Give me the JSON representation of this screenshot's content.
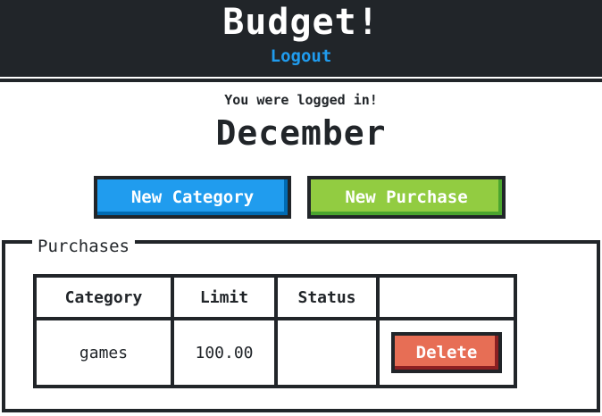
{
  "header": {
    "title": "Budget!",
    "logout_label": "Logout"
  },
  "flash": "You were logged in!",
  "month": "December",
  "actions": {
    "new_category_label": "New Category",
    "new_purchase_label": "New Purchase"
  },
  "purchases": {
    "legend": "Purchases",
    "columns": [
      "Category",
      "Limit",
      "Status",
      ""
    ],
    "rows": [
      {
        "category": "games",
        "limit": "100.00",
        "status": "",
        "action_label": "Delete"
      }
    ]
  },
  "colors": {
    "dark": "#212529",
    "link": "#209cee",
    "primary": "#209cee",
    "success": "#92cc41",
    "error": "#e76e55"
  }
}
